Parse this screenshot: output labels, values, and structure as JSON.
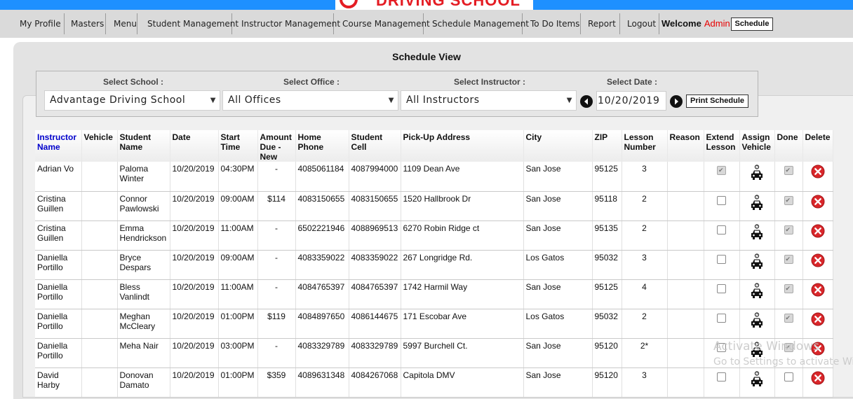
{
  "brand": {
    "logo_text": "DRIVING SCHOOL"
  },
  "nav": {
    "items": [
      "My Profile",
      "Masters",
      "Menu",
      "Student Management",
      "Instructor Management",
      "Course Management",
      "Schedule Management",
      "To Do Items",
      "Report",
      "Logout"
    ],
    "welcome_label": "Welcome",
    "user": "Admin",
    "schedule_button": "Schedule"
  },
  "page": {
    "title": "Schedule View"
  },
  "filters": {
    "school_label": "Select School :",
    "school_value": "Advantage Driving School",
    "office_label": "Select Office :",
    "office_value": "All Offices",
    "instructor_label": "Select Instructor :",
    "instructor_value": "All Instructors",
    "date_label": "Select Date :",
    "date_value": "10/20/2019",
    "print_button": "Print Schedule"
  },
  "table": {
    "headers": [
      "Instructor Name",
      "Vehicle",
      "Student Name",
      "Date",
      "Start Time",
      "Amount Due - New",
      "Home Phone",
      "Student Cell",
      "Pick-Up Address",
      "City",
      "ZIP",
      "Lesson Number",
      "Reason",
      "Extend Lesson",
      "Assign Vehicle",
      "Done",
      "Delete"
    ],
    "rows": [
      {
        "instructor": "Adrian Vo",
        "vehicle": "",
        "student": "Paloma Winter",
        "date": "10/20/2019",
        "start": "04:30PM",
        "amount": "-",
        "home": "4085061184",
        "cell": "4087994000",
        "address": "1109 Dean Ave",
        "city": "San Jose",
        "zip": "95125",
        "lesson": "3",
        "reason": "",
        "extend": true,
        "done": true
      },
      {
        "instructor": "Cristina Guillen",
        "vehicle": "",
        "student": "Connor Pawlowski",
        "date": "10/20/2019",
        "start": "09:00AM",
        "amount": "$114",
        "home": "4083150655",
        "cell": "4083150655",
        "address": "1520 Hallbrook Dr",
        "city": "San Jose",
        "zip": "95118",
        "lesson": "2",
        "reason": "",
        "extend": false,
        "done": true
      },
      {
        "instructor": "Cristina Guillen",
        "vehicle": "",
        "student": "Emma Hendrickson",
        "date": "10/20/2019",
        "start": "11:00AM",
        "amount": "-",
        "home": "6502221946",
        "cell": "4088969513",
        "address": "6270 Robin Ridge ct",
        "city": "San Jose",
        "zip": "95135",
        "lesson": "2",
        "reason": "",
        "extend": false,
        "done": true
      },
      {
        "instructor": "Daniella Portillo",
        "vehicle": "",
        "student": "Bryce Despars",
        "date": "10/20/2019",
        "start": "09:00AM",
        "amount": "-",
        "home": "4083359022",
        "cell": "4083359022",
        "address": "267 Longridge Rd.",
        "city": "Los Gatos",
        "zip": "95032",
        "lesson": "3",
        "reason": "",
        "extend": false,
        "done": true
      },
      {
        "instructor": "Daniella Portillo",
        "vehicle": "",
        "student": "Bless Vanlindt",
        "date": "10/20/2019",
        "start": "11:00AM",
        "amount": "-",
        "home": "4084765397",
        "cell": "4084765397",
        "address": "1742 Harmil Way",
        "city": "San Jose",
        "zip": "95125",
        "lesson": "4",
        "reason": "",
        "extend": false,
        "done": true
      },
      {
        "instructor": "Daniella Portillo",
        "vehicle": "",
        "student": "Meghan McCleary",
        "date": "10/20/2019",
        "start": "01:00PM",
        "amount": "$119",
        "home": "4084897650",
        "cell": "4086144675",
        "address": "171 Escobar Ave",
        "city": "Los Gatos",
        "zip": "95032",
        "lesson": "2",
        "reason": "",
        "extend": false,
        "done": true
      },
      {
        "instructor": "Daniella Portillo",
        "vehicle": "",
        "student": "Meha Nair",
        "date": "10/20/2019",
        "start": "03:00PM",
        "amount": "-",
        "home": "4083329789",
        "cell": "4083329789",
        "address": "5997 Burchell Ct.",
        "city": "San Jose",
        "zip": "95120",
        "lesson": "2*",
        "reason": "",
        "extend": false,
        "done": true
      },
      {
        "instructor": "David Harby",
        "vehicle": "",
        "student": "Donovan Damato",
        "date": "10/20/2019",
        "start": "01:00PM",
        "amount": "$359",
        "home": "4089631348",
        "cell": "4084267068",
        "address": "Capitola DMV",
        "city": "San Jose",
        "zip": "95120",
        "lesson": "3",
        "reason": "",
        "extend": false,
        "done": false
      }
    ]
  },
  "icons": {
    "car": "car-icon",
    "delete": "delete-icon",
    "prev": "prev-date-icon",
    "next": "next-date-icon",
    "dropdown": "chevron-down-icon"
  },
  "watermark": {
    "line1": "Activate Windows",
    "line2": "Go to Settings to activate Windows."
  },
  "colors": {
    "nav_blue": "#1e90ff",
    "brand_red": "#e41c23",
    "admin_red": "#e80000",
    "instructor_header": "#0000cc",
    "delete_red": "#d9262a"
  }
}
